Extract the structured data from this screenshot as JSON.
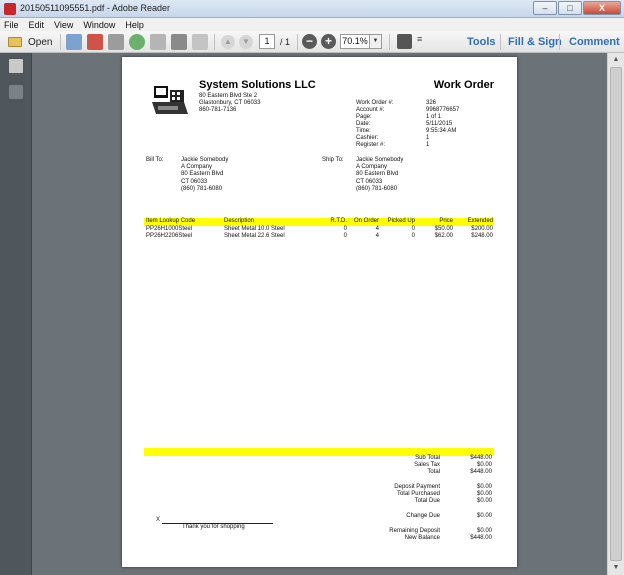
{
  "window": {
    "title": "20150511095551.pdf - Adobe Reader",
    "min": "–",
    "max": "□",
    "close": "X"
  },
  "menu": [
    "File",
    "Edit",
    "View",
    "Window",
    "Help"
  ],
  "toolbar": {
    "open_label": "Open",
    "page_current": "1",
    "page_total": "/ 1",
    "zoom": "70.1%",
    "tools_label": "Tools",
    "fill_sign_label": "Fill & Sign",
    "comment_label": "Comment"
  },
  "document": {
    "company": {
      "name": "System Solutions LLC",
      "address1": "80 Eastern Blvd Ste 2",
      "address2": "Glastonbury, CT  06033",
      "phone": "860-781-7136"
    },
    "title": "Work Order",
    "meta": [
      {
        "label": "Work Order #:",
        "value": "326"
      },
      {
        "label": "Account #:",
        "value": "9968776657"
      },
      {
        "label": "Page:",
        "value": "1 of 1"
      },
      {
        "label": "Date:",
        "value": "5/11/2015"
      },
      {
        "label": "Time:",
        "value": "9:55:34 AM"
      },
      {
        "label": "Cashier:",
        "value": "1"
      },
      {
        "label": "Register #:",
        "value": "1"
      }
    ],
    "bill_to": {
      "label": "Bill To:",
      "lines": [
        "Jackie Somebody",
        "A Company",
        "80 Eastern Blvd",
        "CT  06033",
        "(860) 781-6080"
      ]
    },
    "ship_to": {
      "label": "Ship To:",
      "lines": [
        "Jackie Somebody",
        "A Company",
        "80 Eastern Blvd",
        "CT  06033",
        "(860) 781-6080"
      ]
    },
    "columns": {
      "code": "Item Lookup Code",
      "description": "Description",
      "rtd": "R.T.D.",
      "on_order": "On Order",
      "picked_up": "Picked Up",
      "price": "Price",
      "extended": "Extended"
    },
    "items": [
      {
        "code": "PP26H1000Steel",
        "description": "Sheet Metal 10.0 Steel",
        "rtd": "0",
        "on_order": "4",
        "picked_up": "0",
        "price": "$50.00",
        "extended": "$200.00"
      },
      {
        "code": "PP26H2206Steel",
        "description": "Sheet Metal 22.6 Steel",
        "rtd": "0",
        "on_order": "4",
        "picked_up": "0",
        "price": "$62.00",
        "extended": "$248.00"
      }
    ],
    "totals": [
      {
        "label": "Sub Total",
        "value": "$448.00"
      },
      {
        "label": "Sales Tax",
        "value": "$0.00"
      },
      {
        "label": "Total",
        "value": "$448.00"
      },
      {
        "label": "Deposit Payment",
        "value": "$0.00"
      },
      {
        "label": "Total Purchased",
        "value": "$0.00"
      },
      {
        "label": "Total Due",
        "value": "$0.00"
      },
      {
        "label": "Change Due",
        "value": "$0.00"
      },
      {
        "label": "Remaining Deposit",
        "value": "$0.00"
      },
      {
        "label": "New Balance",
        "value": "$448.00"
      }
    ],
    "signature_x": "X",
    "thanks": "Thank you for shopping"
  }
}
